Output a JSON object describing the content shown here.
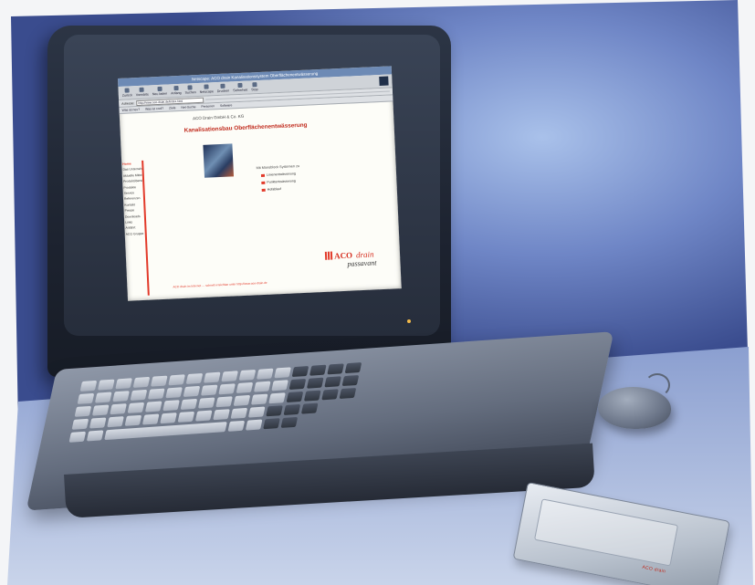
{
  "colors": {
    "backdrop_top": "#4b5fa4",
    "backdrop_light": "#a9c1ea",
    "brand_red": "#e23a2a",
    "window_title_blue": "#6d8ab5"
  },
  "browser": {
    "title": "Netscape: ACO drain Kanalisationssystem Oberflächenentwässerung",
    "toolbar": [
      "Zurück",
      "Vorwärts",
      "Neu laden",
      "Anfang",
      "Suchen",
      "Netscape",
      "Drucken",
      "Sicherheit",
      "Stop"
    ],
    "address_label": "Adresse:",
    "address_value": "http://www.aco-drain.de/index.html",
    "links": [
      "Was ist neu?",
      "Was ist cool?",
      "Ziele",
      "Net-Suche",
      "Personen",
      "Software"
    ]
  },
  "website": {
    "company": "ACO Drain GmbH & Co. KG",
    "headline": "Kanalisationsbau Oberflächenentwässerung",
    "nav": [
      "Home",
      "Das Unternehmen",
      "Aktuelle Mitteilungen",
      "Produktübersicht",
      "Produkte",
      "Service",
      "Referenzen",
      "Kontakt",
      "Presse",
      "Downloads",
      "Links",
      "Anfahrt",
      "ACO Gruppe"
    ],
    "product_line": "Mit Monoblock Systemen zu",
    "bullets": [
      "Linienentwässerung",
      "Punktentwässerung",
      "Hofablauf"
    ],
    "logo_aco": "ACO",
    "logo_drain": "drain",
    "logo_passavant": "passavant",
    "footer": "ACO drain im Internet — schnell erreichbar unter http://www.aco-drain.de"
  },
  "pccard": {
    "label": "ACO drain"
  }
}
